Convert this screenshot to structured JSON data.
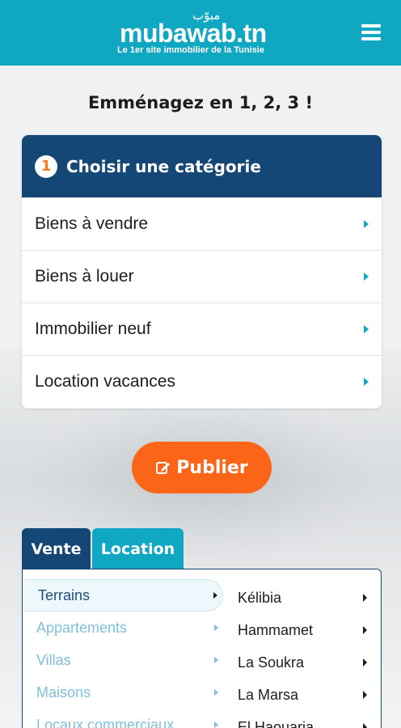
{
  "header": {
    "logo_arabic": "مبوّب",
    "logo_text": "mubawab.tn",
    "tagline": "Le 1er site immobilier de la Tunisie"
  },
  "headline": "Emménagez en 1, 2, 3 !",
  "categories": {
    "step": "1",
    "title": "Choisir une catégorie",
    "items": [
      "Biens à vendre",
      "Biens à louer",
      "Immobilier neuf",
      "Location vacances"
    ]
  },
  "publish_label": "Publier",
  "tabs": [
    "Vente",
    "Location"
  ],
  "property_types": [
    "Terrains",
    "Appartements",
    "Villas",
    "Maisons",
    "Locaux commerciaux"
  ],
  "cities": [
    "Kélibia",
    "Hammamet",
    "La Soukra",
    "La Marsa",
    "El Haouaria"
  ],
  "colors": {
    "header": "#10a7c3",
    "navy": "#144676",
    "accent": "#fb6518"
  },
  "icons": {
    "menu": "hamburger-menu-icon",
    "publish": "edit-icon",
    "chevron": "chevron-right-icon"
  }
}
